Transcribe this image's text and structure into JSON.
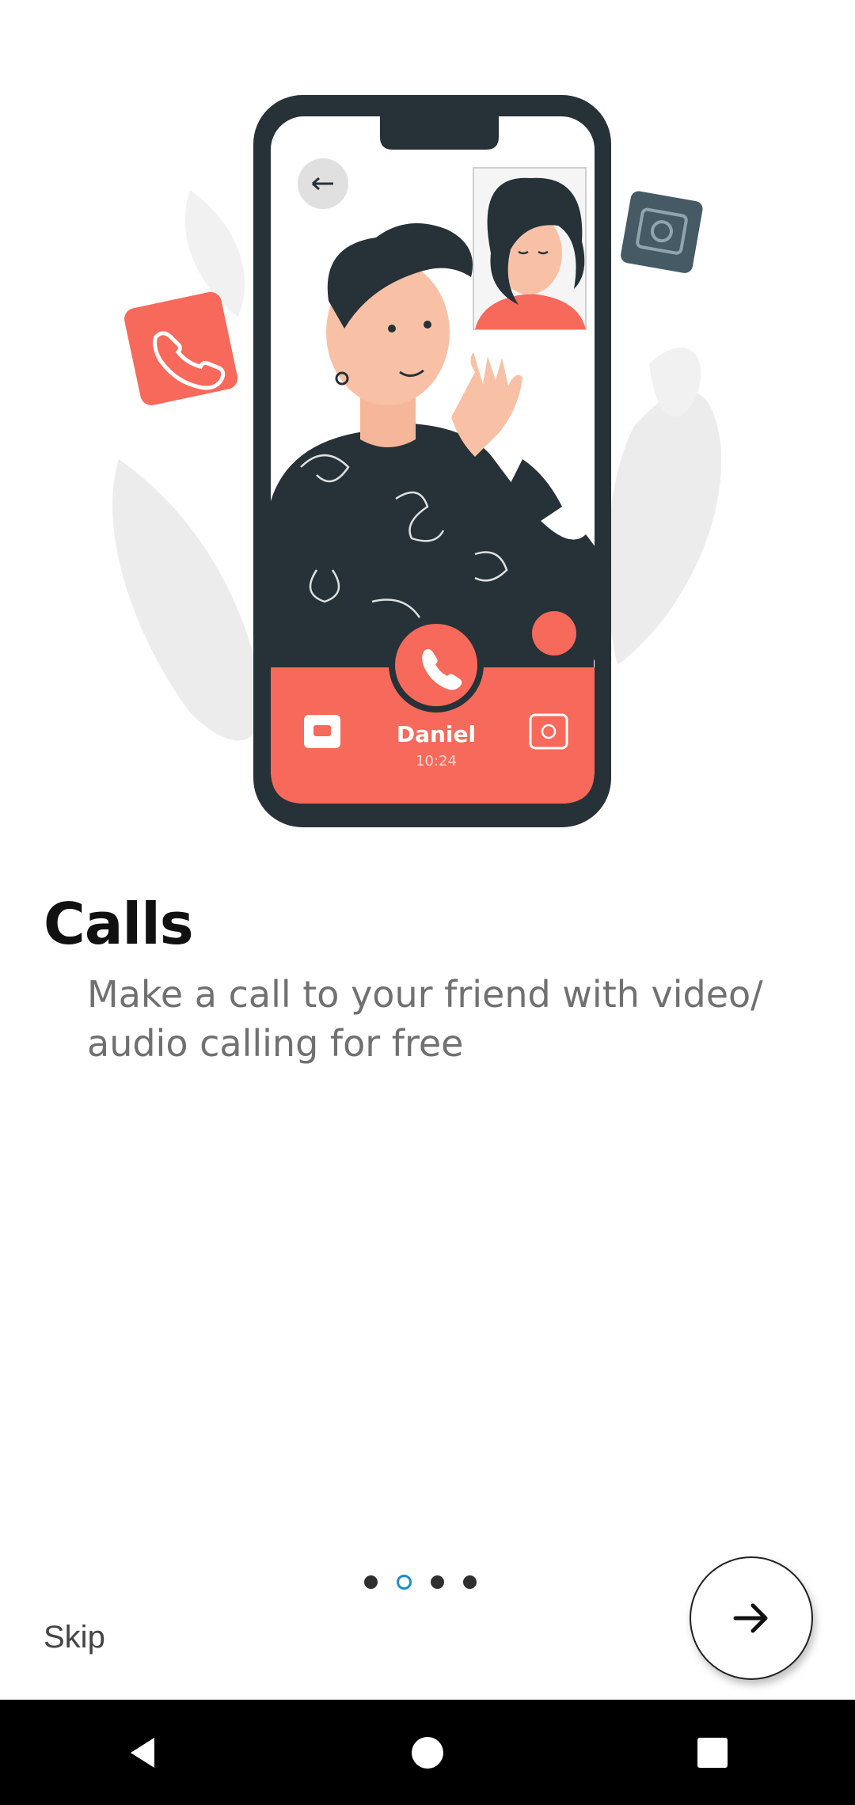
{
  "illustration": {
    "caller_name": "Daniel",
    "call_time": "10:24",
    "accent_color": "#f7695a",
    "dark_color": "#263238"
  },
  "onboarding": {
    "title": "Calls",
    "description": "Make a call to your friend with video/ audio calling for free",
    "current_page": 2,
    "total_pages": 4,
    "active_dot_color": "#1a8fd0"
  },
  "footer": {
    "skip_label": "Skip",
    "next_icon": "arrow-right-icon"
  },
  "navbar": {
    "back_icon": "back-triangle-icon",
    "home_icon": "home-circle-icon",
    "recents_icon": "recents-square-icon"
  }
}
